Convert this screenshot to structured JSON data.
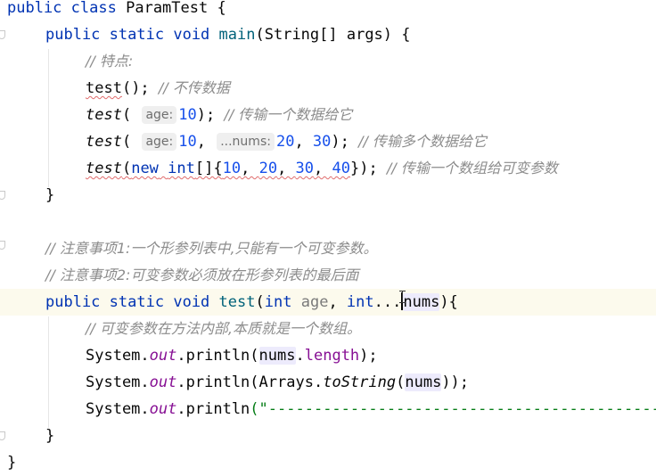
{
  "code": {
    "kw_public": "public",
    "kw_class": "class",
    "class_name": "ParamTest",
    "brace_open": "{",
    "brace_close": "}",
    "kw_static": "static",
    "kw_void": "void",
    "kw_new": "new",
    "kw_int": "int",
    "main_name": "main",
    "main_params": "(String[] args) {",
    "comment_features": "// 特点:",
    "call_name": "test",
    "call1_rest": "(); ",
    "comment_call1": "// 不传数据",
    "call2_open": "( ",
    "hint_age": "age:",
    "val_10": "10",
    "call2_rest": "); ",
    "comment_call2": "// 传输一个数据给它",
    "comma": ", ",
    "hint_nums": "...nums:",
    "val_20": "20",
    "val_30": "30",
    "val_40": "40",
    "comment_call3": "// 传输多个数据给它",
    "array_open": "[]{",
    "array_close": "}); ",
    "comment_call4": "// 传输一个数组给可变参数",
    "note1": "// 注意事项1:一个形参列表中,只能有一个可变参数。",
    "note2": "// 注意事项2:可变参数必须放在形参列表的最后面",
    "param_age": "age",
    "varargs_dots": "...",
    "param_nums": "nums",
    "method_tail": "){",
    "comment_inner": "// 可变参数在方法内部,本质就是一个数组。",
    "system": "System",
    "out": "out",
    "println": "println",
    "length": "length",
    "arrays": "Arrays",
    "to_string": "toString",
    "print3_open": "(\"",
    "dashes": "--------------------------------------------"
  }
}
